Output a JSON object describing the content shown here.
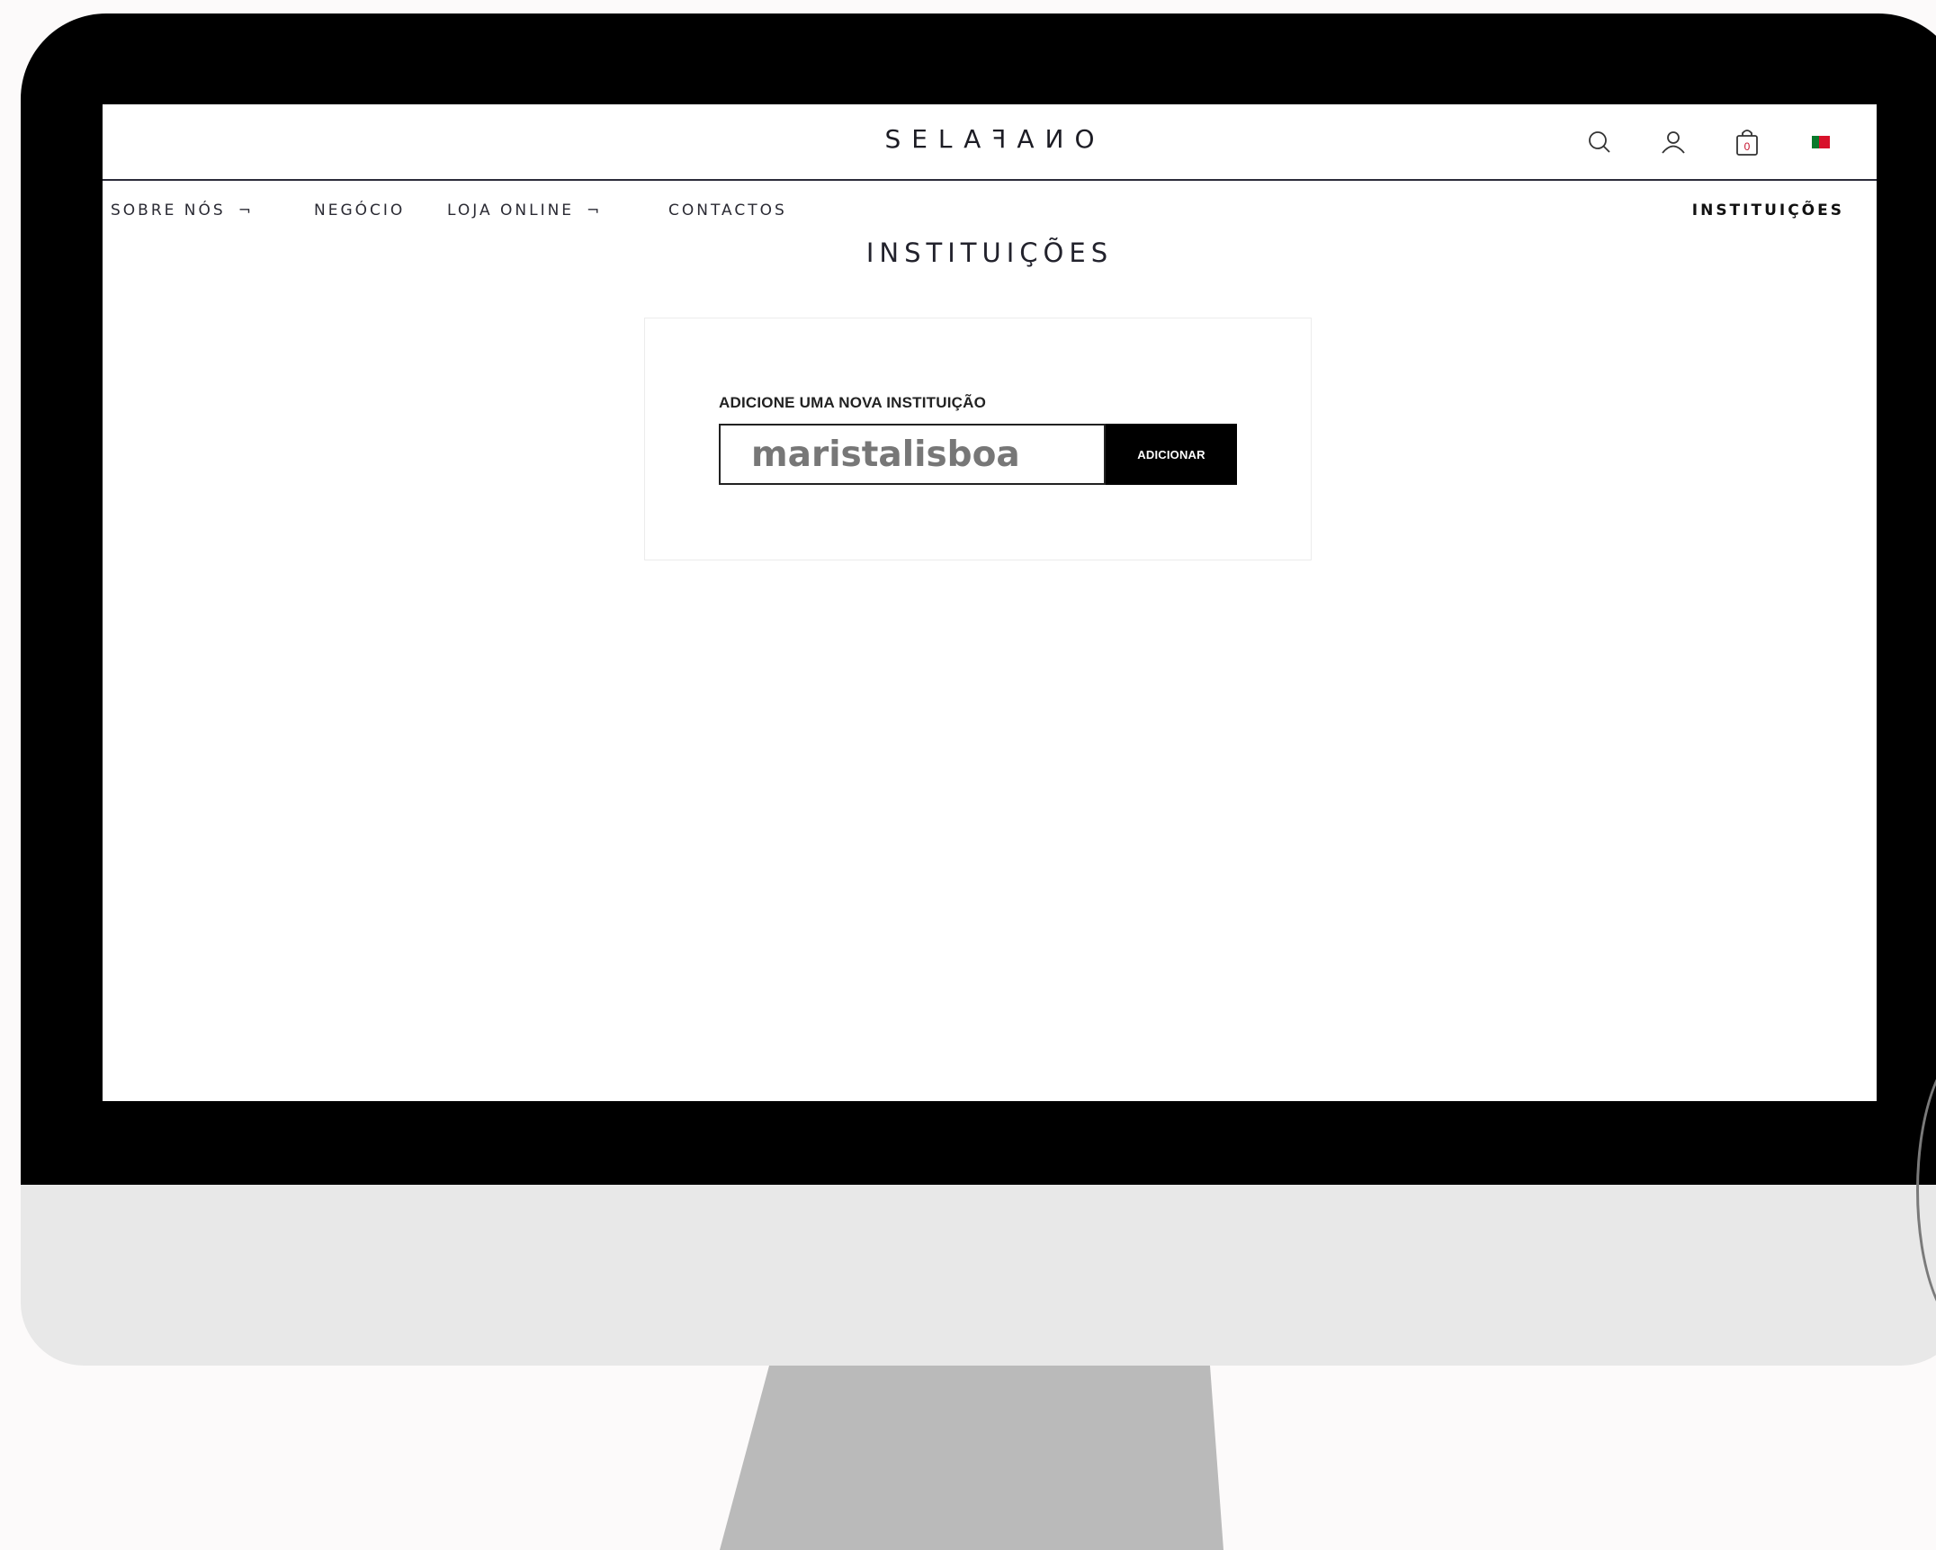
{
  "brand": {
    "logo": "SELAꟻAИO"
  },
  "header": {
    "icons": [
      "search-icon",
      "user-icon",
      "cart-icon",
      "flag-icon"
    ],
    "cart_count": "0",
    "flag_colors": {
      "green": "#0a7a2c",
      "red": "#d8112a"
    }
  },
  "nav": {
    "items": [
      {
        "label": "SOBRE NÓS",
        "dropdown_glyph": "¬"
      },
      {
        "label": "NEGÓCIO"
      },
      {
        "label": "LOJA ONLINE",
        "dropdown_glyph": "¬"
      },
      {
        "label": "CONTACTOS"
      }
    ],
    "right_item": "INSTITUIÇÕES"
  },
  "main": {
    "title": "INSTITUIÇÕES",
    "form": {
      "label": "ADICIONE UMA NOVA INSTITUIÇÃO",
      "input_value": "maristalisboa",
      "button_label": "ADICIONAR"
    }
  }
}
